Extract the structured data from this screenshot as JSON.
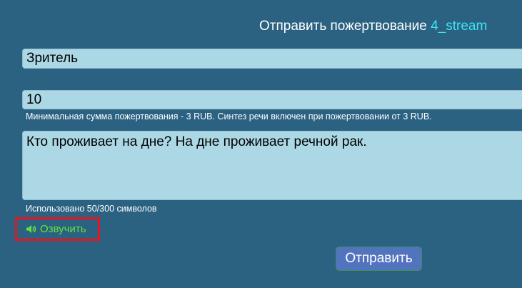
{
  "header": {
    "prefix": "Отправить пожертвование",
    "streamer": "4_stream"
  },
  "form": {
    "name_value": "Зритель",
    "amount_value": "10",
    "amount_hint": "Минимальная сумма пожертвования - 3 RUB. Синтез речи включен при пожертвовании от 3 RUB.",
    "message_value": "Кто проживает на дне? На дне проживает речной рак.",
    "counter_text": "Использовано 50/300 символов",
    "speak_label": "Озвучить",
    "speak_icon": "speaker-icon",
    "submit_label": "Отправить"
  },
  "colors": {
    "background": "#2b6282",
    "field": "#acd8e6",
    "accent_streamer": "#3fe3f2",
    "speak_green": "#64e23c",
    "highlight_red": "#e8141c",
    "submit_bg": "#5273bd"
  }
}
